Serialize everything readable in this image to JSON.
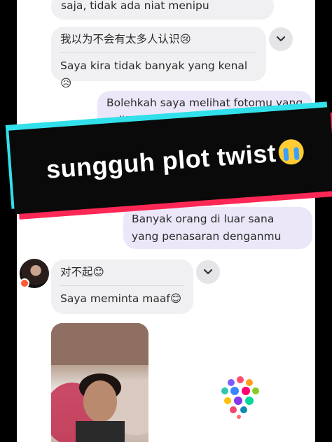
{
  "messages": [
    {
      "id": "m1",
      "text": "saja, tidak ada niat menipu"
    },
    {
      "id": "m2",
      "original": "我以为不会有太多人认识😢",
      "translation": "Saya kira tidak banyak yang kenal😥"
    },
    {
      "id": "m3",
      "text": "Bolehkah saya melihat fotomu yang asli?"
    },
    {
      "id": "m4",
      "text": "Banyak orang di luar sana yang penasaran denganmu"
    },
    {
      "id": "m5",
      "original": "对不起😊",
      "translation": "Saya meminta maaf😊"
    }
  ],
  "banner": {
    "text": "sungguh plot twist",
    "icon": "loudly-crying-face-icon"
  },
  "colors": {
    "incoming": "#f0f0f2",
    "outgoing": "#ebe7f8",
    "banner_cyan": "#31e0ea",
    "banner_red": "#ff2755",
    "banner_black": "#0a0a0a"
  }
}
